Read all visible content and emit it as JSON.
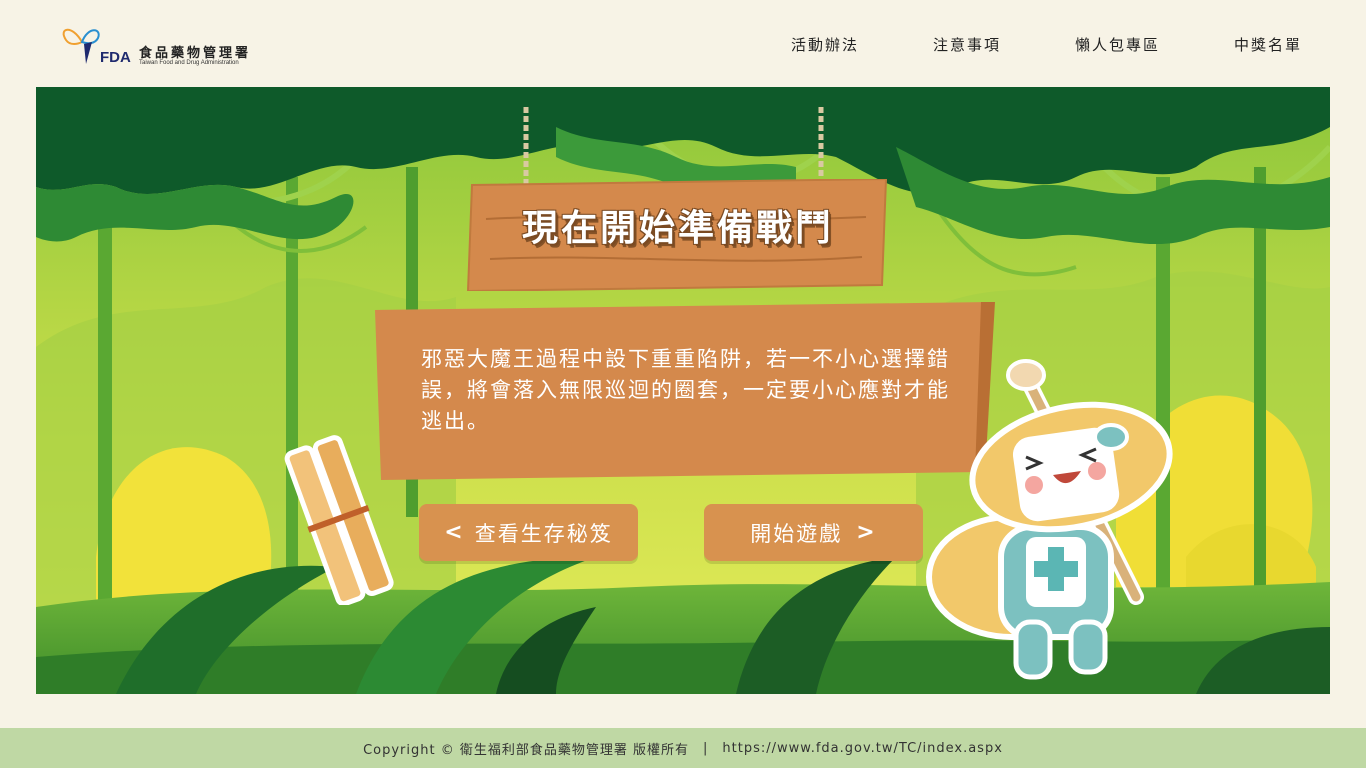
{
  "header": {
    "logo": {
      "abbr": "FDA",
      "name_cn": "食品藥物管理署",
      "name_en": "Taiwan Food and Drug Administration"
    },
    "nav": [
      {
        "label": "活動辦法"
      },
      {
        "label": "注意事項"
      },
      {
        "label": "懶人包專區"
      },
      {
        "label": "中獎名單"
      }
    ]
  },
  "main": {
    "title": "現在開始準備戰鬥",
    "message": "邪惡大魔王過程中設下重重陷阱，若一不小心選擇錯誤，將會落入無限巡迴的圈套，一定要小心應對才能逃出。",
    "buttons": {
      "tips_label": "查看生存秘笈",
      "start_label": "開始遊戲"
    }
  },
  "footer": {
    "copyright": "Copyright © 衛生福利部食品藥物管理署 版權所有",
    "separator": "|",
    "url": "https://www.fda.gov.tw/TC/index.aspx"
  },
  "icons": [
    "fda-logo-icon",
    "chevron-left-icon",
    "chevron-right-icon"
  ],
  "colors": {
    "accent": "#d8924f",
    "footer_bg": "#bfd8a4",
    "page_bg": "#f7f3e6",
    "wood": "#d4894c"
  }
}
